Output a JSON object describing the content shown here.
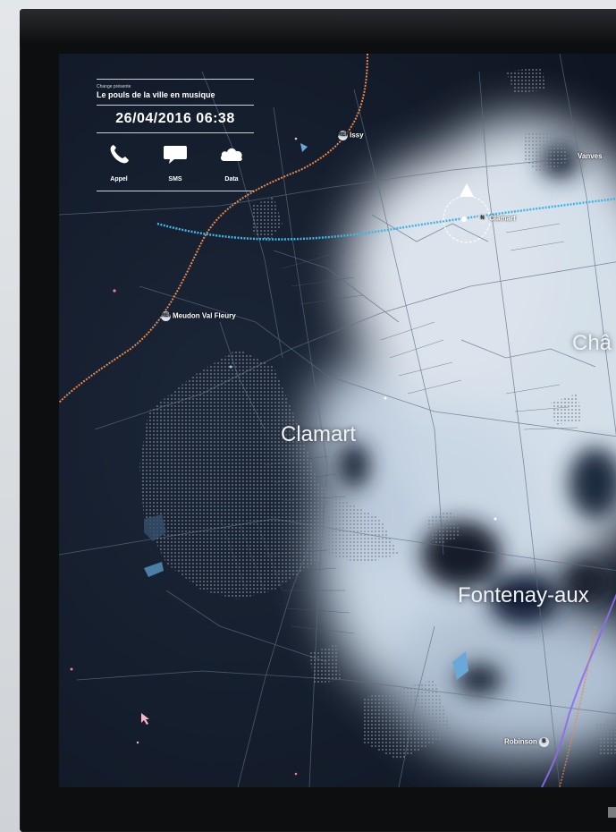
{
  "panel": {
    "subtitle": "Change présente",
    "title": "Le pouls de la ville en musique",
    "datetime": "26/04/2016 06:38",
    "icons": [
      {
        "icon": "phone-icon",
        "label": "Appel"
      },
      {
        "icon": "sms-icon",
        "label": "SMS"
      },
      {
        "icon": "cloud-icon",
        "label": "Data"
      }
    ]
  },
  "stations": {
    "issy": "Issy",
    "meudon": "Meudon Val Fleury",
    "clamart": "Clamart",
    "vanves": "Vanves",
    "robinson": "Robinson"
  },
  "badges": {
    "rer": "RER",
    "transilien": "N",
    "rer_b": "B"
  },
  "towns": {
    "clamart": "Clamart",
    "fontenay": "Fontenay-aux",
    "chatillon": "Châ"
  },
  "colors": {
    "screen_bg": "#121b2a",
    "heat": "#dfeaf5",
    "rail_orange": "#e8884a",
    "rail_cyan": "#3fb6e6",
    "rail_purple": "#8d6cf0"
  }
}
